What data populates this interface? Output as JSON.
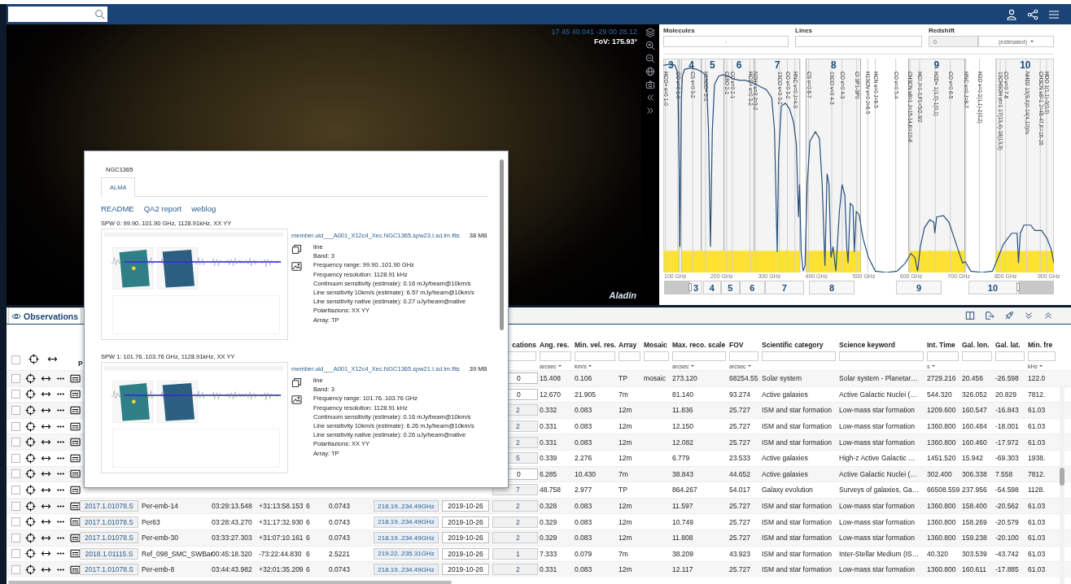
{
  "sky": {
    "coordinates": "17 45 40.041 -29 00 28.12",
    "fov": "FoV: 175.93°",
    "logo": "Aladin"
  },
  "spectrum": {
    "molecules": {
      "label": "Molecules",
      "value": "-"
    },
    "lines": {
      "label": "Lines"
    },
    "redshift": {
      "label": "Redshift",
      "value": "0",
      "disabled": true,
      "mode": "(estimated)"
    },
    "bands": [
      {
        "label": "3"
      },
      {
        "label": "4"
      },
      {
        "label": "5"
      },
      {
        "label": "6"
      },
      {
        "label": "7"
      },
      {
        "label": "8"
      },
      {
        "label": "9"
      },
      {
        "label": "10"
      }
    ],
    "line_labels": [
      "HCO+ v=0 1-0",
      "CO v=0 1-0",
      "CS v=0 3-2",
      "H13CO+ 2-1",
      "C18O 2-1",
      "CO v=0 2-1",
      "HCO+ v=0 3-2",
      "N2H+ v=0 J=3-2",
      "13CO v=0 3-2",
      "CO v=0 3-2",
      "HNC v=0 J=4-3",
      "CS v=0 8-7",
      "13CO v=0 4-3",
      "CO v=0 4-3",
      "CI 3P1-3P0",
      "H13CN v=0 J=6-5",
      "HCN v=0 J=6-5",
      "CO v=0 5-4",
      "CH3CN v8=1 J=15-14,K=10-8",
      "HCl J=1-0,F1=5/2-3/2",
      "H2D+ 1(1,0)-1(0,1)",
      "CO v=0 6-5",
      "HNC v=0 J=8-7",
      "H2O v=0 2(1,1)-2(0,2)",
      "13CH3OH vt=1 17(13,4)-18(13,3)",
      "CO v=0 7-6",
      "NHD2 13(9,4)0-14(4,10)0s",
      "CH3CN v8=1 J=48-47,K=16-16",
      "HDO 1(1,1)-0(0,0)"
    ],
    "axis_labels": [
      "100 GHz",
      "200 GHz",
      "300 GHz",
      "400 GHz",
      "500 GHz",
      "600 GHz",
      "700 GHz",
      "800 GHz",
      "900 GHz"
    ],
    "band_buttons": [
      "3",
      "4",
      "5",
      "6",
      "7",
      "8",
      "9",
      "10"
    ]
  },
  "observations": {
    "tab": {
      "label": "Observations",
      "selected": true
    },
    "select_all": {
      "checked": false
    },
    "columns": [
      {
        "kind": "link",
        "label": "P"
      },
      {
        "kind": "text"
      },
      {
        "kind": "text"
      },
      {
        "kind": "text"
      },
      {
        "kind": "text"
      },
      {
        "kind": "text"
      },
      {
        "kind": "range"
      },
      {
        "kind": "date"
      },
      {
        "kind": "count",
        "label": "cations"
      },
      {
        "kind": "text",
        "label": "Ang. res.",
        "unit": "arcsec"
      },
      {
        "kind": "text",
        "label": "Min. vel. res.",
        "unit": "km/s"
      },
      {
        "kind": "text",
        "label": "Array"
      },
      {
        "kind": "text",
        "label": "Mosaic"
      },
      {
        "kind": "text",
        "label": "Max. reco. scale",
        "unit": "arcsec"
      },
      {
        "kind": "text",
        "label": "FOV",
        "unit": "arcsec"
      },
      {
        "kind": "text",
        "label": "Scientific category"
      },
      {
        "kind": "text",
        "label": "Science keyword"
      },
      {
        "kind": "text",
        "label": "Int. Time",
        "unit": "s"
      },
      {
        "kind": "text",
        "label": "Gal. lon."
      },
      {
        "kind": "text",
        "label": "Gal. lat."
      },
      {
        "kind": "text",
        "label": "Min. fre",
        "unit": "kHz"
      }
    ],
    "rows": [
      {
        "checked": false,
        "cells": [
          null,
          null,
          null,
          null,
          null,
          null,
          null,
          null,
          {
            "text": "0",
            "link": false
          },
          "15.408",
          "0.106",
          "TP",
          "mosaic",
          "273.120",
          "68254.55",
          "Solar system",
          "Solar system - Planetar…",
          "2729.216",
          "20.456",
          "-26.598",
          "122.0"
        ]
      },
      {
        "checked": false,
        "cells": [
          null,
          null,
          null,
          null,
          null,
          null,
          null,
          null,
          {
            "text": "0",
            "link": false
          },
          "12.670",
          "21.905",
          "7m",
          null,
          "81.140",
          "93.274",
          "Active galaxies",
          "Active Galactic Nuclei (…",
          "544.320",
          "326.052",
          "20.829",
          "7812."
        ]
      },
      {
        "checked": false,
        "cells": [
          null,
          null,
          null,
          null,
          null,
          null,
          null,
          null,
          {
            "text": "2",
            "link": true
          },
          "0.332",
          "0.083",
          "12m",
          null,
          "11.836",
          "25.727",
          "ISM and star formation",
          "Low-mass star formation",
          "1209.600",
          "160.547",
          "-16.843",
          "61.03"
        ]
      },
      {
        "checked": false,
        "cells": [
          null,
          null,
          null,
          null,
          null,
          null,
          null,
          null,
          {
            "text": "2",
            "link": true
          },
          "0.331",
          "0.083",
          "12m",
          null,
          "12.150",
          "25.727",
          "ISM and star formation",
          "Low-mass star formation",
          "1360.800",
          "160.484",
          "-18.001",
          "61.03"
        ]
      },
      {
        "checked": false,
        "cells": [
          null,
          null,
          null,
          null,
          null,
          null,
          null,
          null,
          {
            "text": "2",
            "link": true
          },
          "0.331",
          "0.083",
          "12m",
          null,
          "12.082",
          "25.727",
          "ISM and star formation",
          "Low-mass star formation",
          "1360.800",
          "160.460",
          "-17.972",
          "61.03"
        ]
      },
      {
        "checked": false,
        "cells": [
          null,
          null,
          null,
          null,
          null,
          null,
          null,
          null,
          {
            "text": "5",
            "link": true
          },
          "0.339",
          "2.276",
          "12m",
          null,
          "6.779",
          "23.533",
          "Active galaxies",
          "High-z Active Galactic …",
          "1451.520",
          "15.942",
          "-69.303",
          "1938."
        ]
      },
      {
        "checked": false,
        "cells": [
          null,
          null,
          null,
          null,
          null,
          null,
          null,
          null,
          {
            "text": "0",
            "link": false
          },
          "6.285",
          "10.430",
          "7m",
          null,
          "38.843",
          "44.652",
          "Active galaxies",
          "Active Galactic Nuclei (…",
          "302.400",
          "306.338",
          "7.558",
          "7812."
        ]
      },
      {
        "checked": false,
        "cells": [
          null,
          null,
          null,
          null,
          null,
          null,
          null,
          null,
          {
            "text": "7",
            "link": true
          },
          "48.758",
          "2.977",
          "TP",
          null,
          "864.267",
          "54.017",
          "Galaxy evolution",
          "Surveys of galaxies, Ga…",
          "66508.559",
          "237.956",
          "-54.598",
          "1128."
        ]
      },
      {
        "checked": false,
        "cells": [
          "2017.1.01078.S",
          "Per-emb-14",
          "03:29:13.548",
          "+31:13:58.153",
          "6",
          "0.0743",
          "218.19..234.49GHz",
          "2019-10-26",
          {
            "text": "2",
            "link": true
          },
          "0.328",
          "0.083",
          "12m",
          null,
          "11.597",
          "25.727",
          "ISM and star formation",
          "Low-mass star formation",
          "1360.800",
          "158.400",
          "-20.562",
          "61.03"
        ]
      },
      {
        "checked": false,
        "cells": [
          "2017.1.01078.S",
          "Per63",
          "03:28:43.270",
          "+31:17:32.930",
          "6",
          "0.0743",
          "218.19..234.49GHz",
          "2019-10-26",
          {
            "text": "2",
            "link": true
          },
          "0.329",
          "0.083",
          "12m",
          null,
          "10.749",
          "25.727",
          "ISM and star formation",
          "Low-mass star formation",
          "1360.800",
          "158.269",
          "-20.579",
          "61.03"
        ]
      },
      {
        "checked": false,
        "cells": [
          "2017.1.01078.S",
          "Per-emb-30",
          "03:33:27.303",
          "+31:07:10.161",
          "6",
          "0.0743",
          "218.19..234.49GHz",
          "2019-10-26",
          {
            "text": "2",
            "link": true
          },
          "0.329",
          "0.083",
          "12m",
          null,
          "11.808",
          "25.727",
          "ISM and star formation",
          "Low-mass star formation",
          "1360.800",
          "159.238",
          "-20.100",
          "61.03"
        ]
      },
      {
        "checked": false,
        "cells": [
          "2018.1.01115.S",
          "Ref_098_SMC_SWBar",
          "00:45:18.320",
          "-73:22:44.830",
          "6",
          "2.5221",
          "219.22..235.31GHz",
          "2019-10-26",
          {
            "text": "1",
            "link": true
          },
          "7.333",
          "0.079",
          "7m",
          null,
          "38.209",
          "43.923",
          "ISM and star formation",
          "Inter-Stellar Medium (IS…",
          "40.320",
          "303.539",
          "-43.742",
          "61.03"
        ]
      },
      {
        "checked": false,
        "cells": [
          "2017.1.01078.S",
          "Per-emb-8",
          "03:44:43.982",
          "+32:01:35.209",
          "6",
          "0.0743",
          "218.19..234.49GHz",
          "2019-10-26",
          {
            "text": "2",
            "link": true
          },
          "0.331",
          "0.083",
          "12m",
          null,
          "12.117",
          "25.727",
          "ISM and star formation",
          "Low-mass star formation",
          "1360.800",
          "160.611",
          "-17.885",
          "61.03"
        ]
      }
    ]
  },
  "popup": {
    "title": "NGC1365",
    "tabs": [
      {
        "label": "ALMA",
        "selected": true
      }
    ],
    "links": [
      "README",
      "QA2 report",
      "weblog"
    ],
    "spws": [
      {
        "heading": "SPW 0: 99.90..101.90 GHz, 1128.91kHz, XX YY",
        "file": "member.uid___A001_X12c4_Xec.NGC1365.spw23.I.sd.im.fits",
        "size": "38 MB",
        "details": [
          "line",
          "Band: 3",
          "Frequency range: 99.90..101.90 GHz",
          "Frequency resolution: 1128.91 kHz",
          "Continuum sensitivity (estimate): 0.16 mJy/beam@10km/s",
          "Line sensitivity 10km/s (estimate): 6.57 mJy/beam@10km/s",
          "Line sensitivity native (estimate): 0.27 uJy/beam@native",
          "Polaritazions: XX YY",
          "Array: TP"
        ]
      },
      {
        "heading": "SPW 1: 101.76..103.76 GHz, 1128.91kHz, XX YY",
        "file": "member.uid___A001_X12c4_Xec.NGC1365.spw21.I.sd.im.fits",
        "size": "39 MB",
        "details": [
          "line",
          "Band: 3",
          "Frequency range: 101.76..103.76 GHz",
          "Frequency resolution: 1128.91 kHz",
          "Continuum sensitivity (estimate): 0.16 mJy/beam@10km/s",
          "Line sensitivity 10km/s (estimate): 6.26 mJy/beam@10km/s",
          "Line sensitivity native (estimate): 0.26 uJy/beam@native",
          "Polaritazions: XX YY",
          "Array: TP"
        ]
      }
    ]
  }
}
